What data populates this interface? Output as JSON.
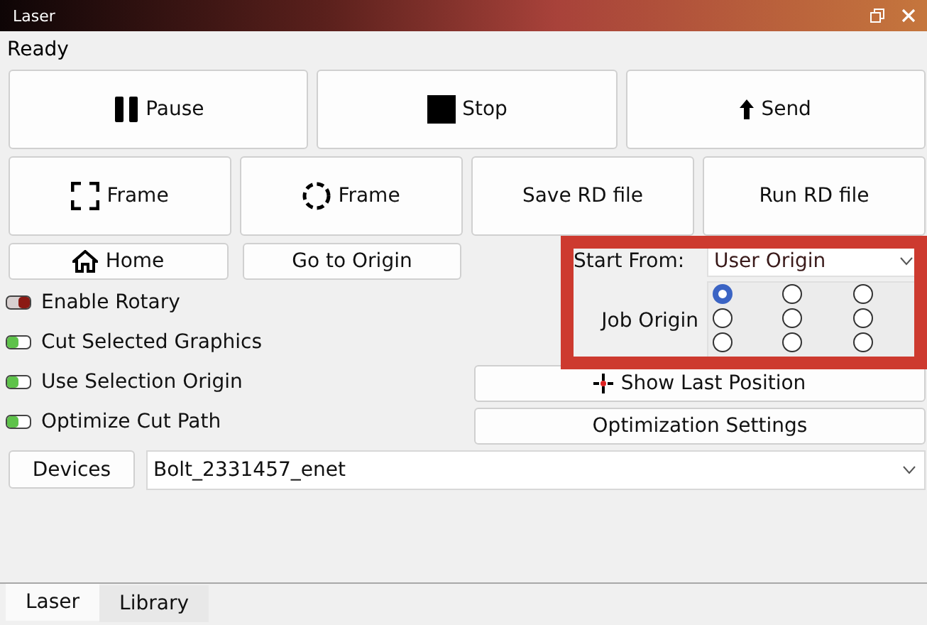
{
  "window": {
    "title": "Laser"
  },
  "status": "Ready",
  "primary_buttons": [
    {
      "label": "Pause",
      "kind": "pause"
    },
    {
      "label": "Stop",
      "kind": "stop"
    },
    {
      "label": "Send",
      "kind": "send"
    }
  ],
  "secondary_buttons": [
    {
      "label": "Frame",
      "kind": "frame-square"
    },
    {
      "label": "Frame",
      "kind": "frame-circle"
    },
    {
      "label": "Save RD file",
      "kind": "none"
    },
    {
      "label": "Run RD file",
      "kind": "none"
    }
  ],
  "home_button": {
    "label": "Home"
  },
  "origin_button": {
    "label": "Go to Origin"
  },
  "options": [
    {
      "label": "Enable Rotary",
      "checked": false
    },
    {
      "label": "Cut Selected Graphics",
      "checked": true
    },
    {
      "label": "Use Selection Origin",
      "checked": true
    },
    {
      "label": "Optimize Cut Path",
      "checked": true
    }
  ],
  "start_from": {
    "label": "Start From:",
    "value": "User Origin"
  },
  "job_origin": {
    "label": "Job Origin",
    "positions": [
      {
        "selected": true
      },
      {
        "selected": false
      },
      {
        "selected": false
      },
      {
        "selected": false
      },
      {
        "selected": false
      },
      {
        "selected": false
      },
      {
        "selected": false
      },
      {
        "selected": false
      },
      {
        "selected": false
      }
    ]
  },
  "show_last_position": {
    "label": "Show Last Position"
  },
  "optimization_settings": {
    "label": "Optimization Settings"
  },
  "devices": {
    "label": "Devices",
    "value": "Bolt_2331457_enet"
  },
  "tabs": [
    {
      "label": "Laser",
      "selected": true
    },
    {
      "label": "Library",
      "selected": false
    }
  ]
}
